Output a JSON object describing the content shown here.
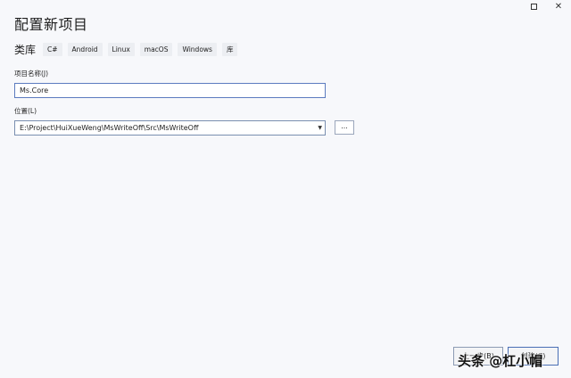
{
  "window": {
    "title": "配置新项目",
    "close_glyph": "✕"
  },
  "categories": {
    "label": "类库",
    "tags": [
      "C#",
      "Android",
      "Linux",
      "macOS",
      "Windows",
      "库"
    ]
  },
  "project_name": {
    "label": "项目名称(J)",
    "value": "Ms.Core"
  },
  "location": {
    "label": "位置(L)",
    "value": "E:\\Project\\HuiXueWeng\\MsWriteOff\\Src\\MsWriteOff",
    "dropdown_glyph": "▼",
    "browse_label": "..."
  },
  "footer": {
    "back_label": "上一步(B)",
    "create_label": "创建(C)"
  },
  "watermark": {
    "text": "头条 @杠小帽"
  }
}
